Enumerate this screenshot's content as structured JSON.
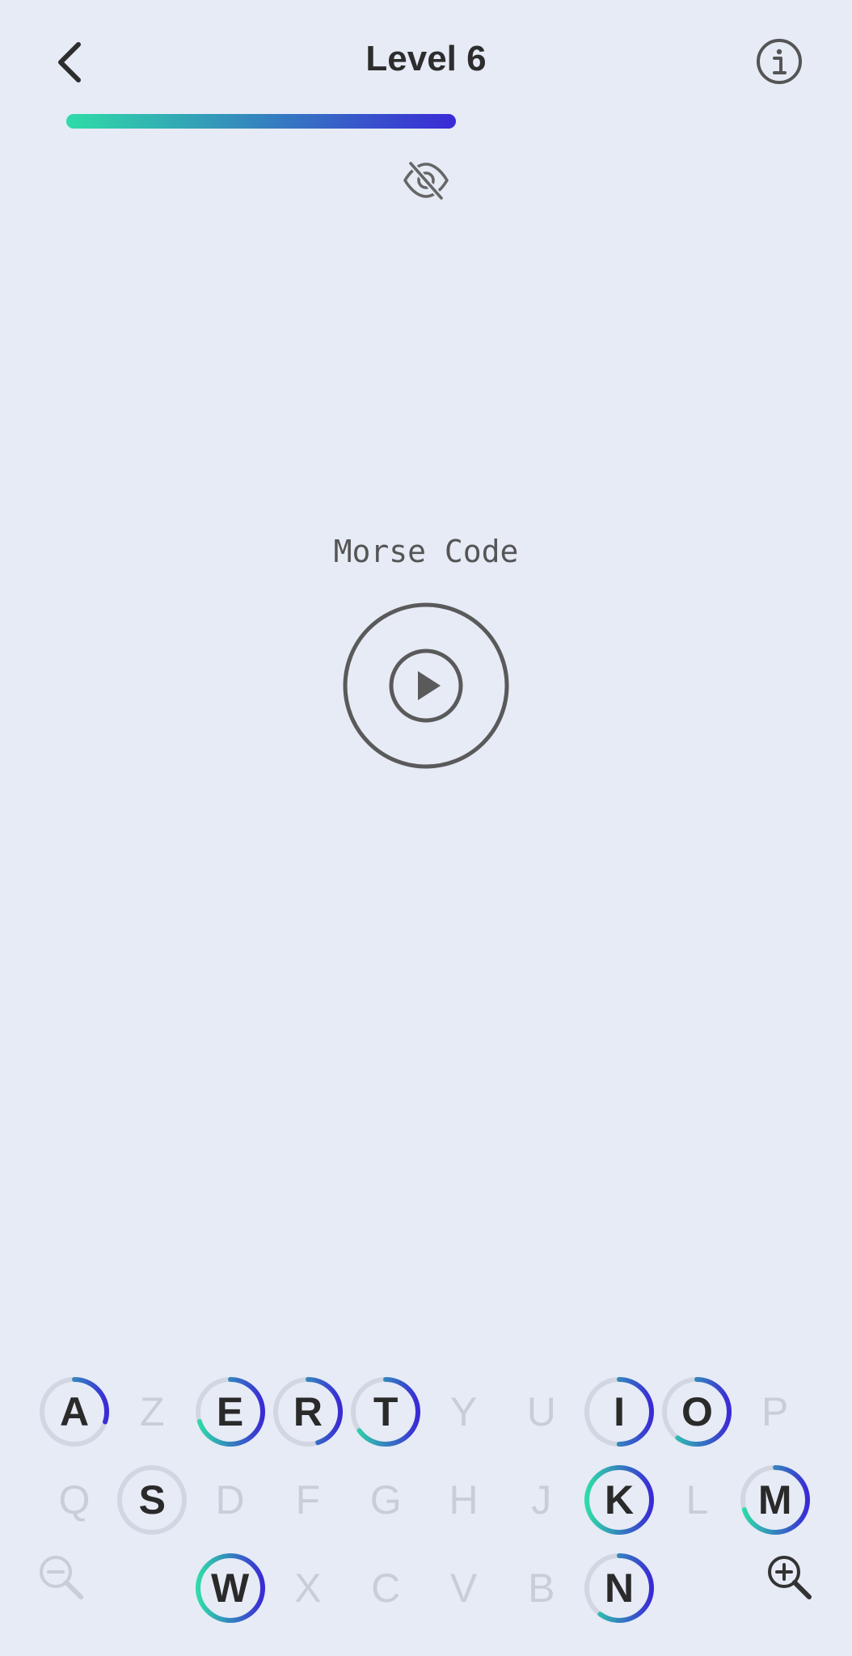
{
  "header": {
    "title": "Level 6",
    "progress": 0.5
  },
  "colors": {
    "gradient_start": "#2fdca7",
    "gradient_end": "#3a2ad6",
    "ring_track": "#d2d6e2"
  },
  "main": {
    "label": "Morse Code"
  },
  "keyboard": {
    "rows": [
      [
        {
          "letter": "A",
          "active": true,
          "progress": 0.3
        },
        {
          "letter": "Z",
          "active": false
        },
        {
          "letter": "E",
          "active": true,
          "progress": 0.7
        },
        {
          "letter": "R",
          "active": true,
          "progress": 0.45
        },
        {
          "letter": "T",
          "active": true,
          "progress": 0.65
        },
        {
          "letter": "Y",
          "active": false
        },
        {
          "letter": "U",
          "active": false
        },
        {
          "letter": "I",
          "active": true,
          "progress": 0.5
        },
        {
          "letter": "O",
          "active": true,
          "progress": 0.6
        },
        {
          "letter": "P",
          "active": false
        }
      ],
      [
        {
          "letter": "Q",
          "active": false
        },
        {
          "letter": "S",
          "active": true,
          "progress": 0.0
        },
        {
          "letter": "D",
          "active": false
        },
        {
          "letter": "F",
          "active": false
        },
        {
          "letter": "G",
          "active": false
        },
        {
          "letter": "H",
          "active": false
        },
        {
          "letter": "J",
          "active": false
        },
        {
          "letter": "K",
          "active": true,
          "progress": 1.0
        },
        {
          "letter": "L",
          "active": false
        },
        {
          "letter": "M",
          "active": true,
          "progress": 0.7
        }
      ],
      [
        {
          "letter": "",
          "active": false,
          "spacer": true
        },
        {
          "letter": "",
          "active": false,
          "spacer": true
        },
        {
          "letter": "W",
          "active": true,
          "progress": 1.0
        },
        {
          "letter": "X",
          "active": false
        },
        {
          "letter": "C",
          "active": false
        },
        {
          "letter": "V",
          "active": false
        },
        {
          "letter": "B",
          "active": false
        },
        {
          "letter": "N",
          "active": true,
          "progress": 0.6
        },
        {
          "letter": "",
          "active": false,
          "spacer": true
        },
        {
          "letter": "",
          "active": false,
          "spacer": true
        }
      ]
    ]
  },
  "icons": {
    "back": "chevron-left-icon",
    "info": "info-icon",
    "visibility": "eye-off-icon",
    "play": "play-icon",
    "zoom_out": "zoom-out-icon",
    "zoom_in": "zoom-in-icon"
  }
}
